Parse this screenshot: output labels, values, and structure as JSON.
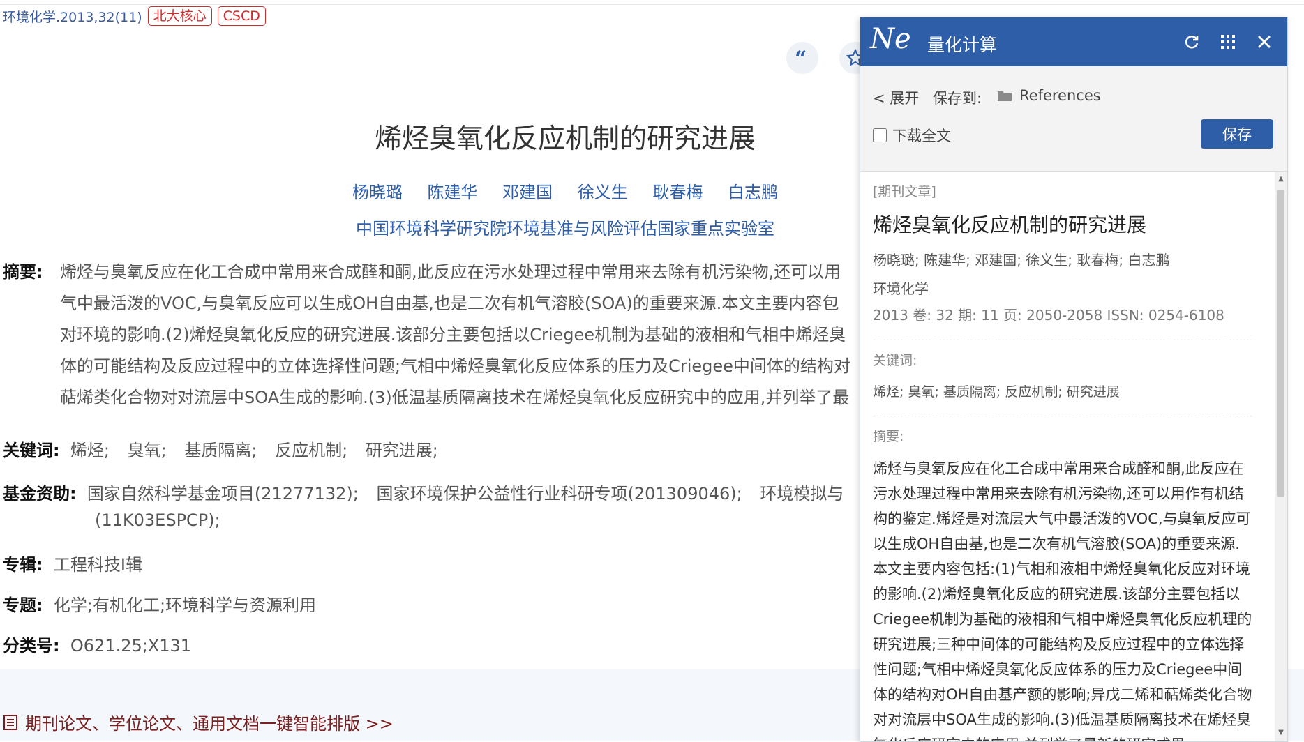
{
  "header": {
    "journal": "环境化学",
    "issue": ".2013,32(11)",
    "tags": [
      "北大核心",
      "CSCD"
    ]
  },
  "article": {
    "title": "烯烃臭氧化反应机制的研究进展",
    "authors": [
      "杨晓璐",
      "陈建华",
      "邓建国",
      "徐义生",
      "耿春梅",
      "白志鹏"
    ],
    "org": "中国环境科学研究院环境基准与风险评估国家重点实验室",
    "abstract_label": "摘要:",
    "abstract_lines": [
      "烯烃与臭氧反应在化工合成中常用来合成醛和酮,此反应在污水处理过程中常用来去除有机污染物,还可以用",
      "气中最活泼的VOC,与臭氧反应可以生成OH自由基,也是二次有机气溶胶(SOA)的重要来源.本文主要内容包",
      "对环境的影响.(2)烯烃臭氧化反应的研究进展.该部分主要包括以Criegee机制为基础的液相和气相中烯烃臭",
      "体的可能结构及反应过程中的立体选择性问题;气相中烯烃臭氧化反应体系的压力及Criegee中间体的结构对",
      "萜烯类化合物对对流层中SOA生成的影响.(3)低温基质隔离技术在烯烃臭氧化反应研究中的应用,并列举了最"
    ],
    "keywords_label": "关键词:",
    "keywords": [
      "烯烃;",
      "臭氧;",
      "基质隔离;",
      "反应机制;",
      "研究进展;"
    ],
    "fund_label": "基金资助:",
    "funds": [
      "国家自然科学基金项目(21277132);",
      "国家环境保护公益性行业科研专项(201309046);",
      "环境模拟与"
    ],
    "fund_line2": "(11K03ESPCP);",
    "album_label": "专辑:",
    "album": "工程科技Ⅰ辑",
    "topic_label": "专题:",
    "topic": "化学;有机化工;环境科学与资源利用",
    "class_label": "分类号:",
    "class": "O621.25;X131",
    "typeset_link": "期刊论文、学位论文、通用文档一键智能排版 >>"
  },
  "panel": {
    "logo": "Ne",
    "title": "量化计算",
    "expand": "< 展开",
    "save_to_label": "保存到:",
    "folder": "References",
    "download_label": "下载全文",
    "save_button": "保存",
    "type": "[期刊文章]",
    "title2": "烯烃臭氧化反应机制的研究进展",
    "authors": "杨晓璐; 陈建华; 邓建国; 徐义生; 耿春梅; 白志鹏",
    "journal": "环境化学",
    "meta": "2013   卷: 32    期: 11    页: 2050-2058    ISSN: 0254-6108",
    "kw_label": "关键词:",
    "kw": "烯烃; 臭氧; 基质隔离; 反应机制; 研究进展",
    "abs_label": "摘要:",
    "abs": "烯烃与臭氧反应在化工合成中常用来合成醛和酮,此反应在污水处理过程中常用来去除有机污染物,还可以用作有机结构的鉴定.烯烃是对流层大气中最活泼的VOC,与臭氧反应可以生成OH自由基,也是二次有机气溶胶(SOA)的重要来源.本文主要内容包括:(1)气相和液相中烯烃臭氧化反应对环境的影响.(2)烯烃臭氧化反应的研究进展.该部分主要包括以Criegee机制为基础的液相和气相中烯烃臭氧化反应机理的研究进展;三种中间体的可能结构及反应过程中的立体选择性问题;气相中烯烃臭氧化反应体系的压力及Criegee中间体的结构对OH自由基产额的影响;异戊二烯和萜烯类化合物对对流层中SOA生成的影响.(3)低温基质隔离技术在烯烃臭氧化反应研究中的应用,并列举了最新的研究成果."
  },
  "colors": {
    "brand_blue": "#2f5ea8",
    "tag_red": "#d02c2c"
  }
}
